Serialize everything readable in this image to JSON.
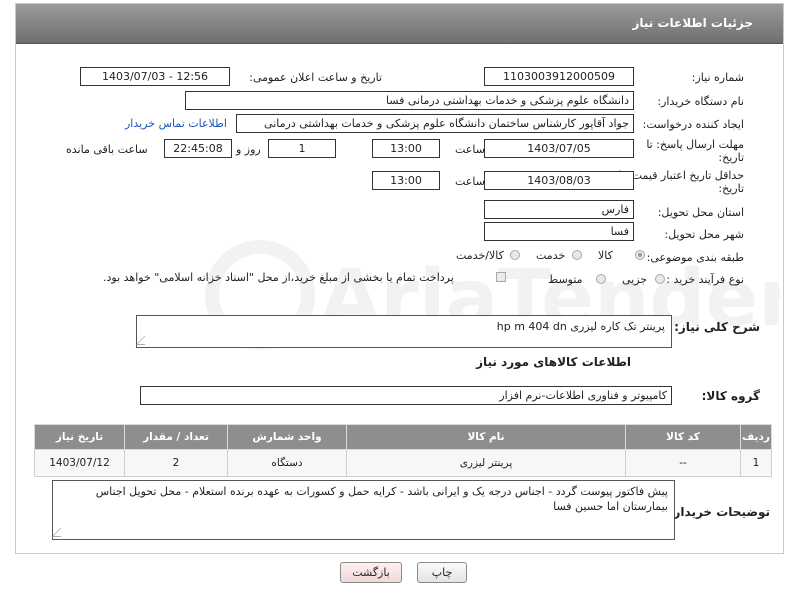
{
  "header": {
    "title": "جزئیات اطلاعات نیاز"
  },
  "need_number": {
    "label": "شماره نیاز:",
    "value": "1103003912000509"
  },
  "announce": {
    "label": "تاریخ و ساعت اعلان عمومی:",
    "value": "1403/07/03 - 12:56"
  },
  "buyer_org": {
    "label": "نام دستگاه خریدار:",
    "value": "دانشگاه علوم پزشکی و خدمات بهداشتی درمانی فسا"
  },
  "creator": {
    "label": "ایجاد کننده درخواست:",
    "value": "جواد آقاپور کارشناس ساختمان دانشگاه علوم پزشکی و خدمات بهداشتی درمانی",
    "contact_link": "اطلاعات تماس خریدار"
  },
  "reply_deadline": {
    "label_line1": "مهلت ارسال پاسخ: تا",
    "label_line2": "تاریخ:",
    "date": "1403/07/05",
    "time_label": "ساعت",
    "time": "13:00",
    "days": "1",
    "days_label": "روز و",
    "remaining": "22:45:08",
    "remaining_label": "ساعت باقی مانده"
  },
  "price_validity": {
    "label_line1": "حداقل تاریخ اعتبار قیمت: تا",
    "label_line2": "تاریخ:",
    "date": "1403/08/03",
    "time_label": "ساعت",
    "time": "13:00"
  },
  "province": {
    "label": "استان محل تحویل:",
    "value": "فارس"
  },
  "city": {
    "label": "شهر محل تحویل:",
    "value": "فسا"
  },
  "category": {
    "label": "طبقه بندی موضوعی:",
    "options": [
      "کالا",
      "خدمت",
      "کالا/خدمت"
    ],
    "selected": "کالا"
  },
  "purchase_process": {
    "label": "نوع فرآیند خرید :",
    "options": [
      "جزیی",
      "متوسط"
    ],
    "note": "پرداخت تمام یا بخشی از مبلغ خرید،از محل \"اسناد خزانه اسلامی\" خواهد بود."
  },
  "description": {
    "label": "شرح کلی نیاز:",
    "value": "پرینتر تک کاره لیزری hp m 404 dn"
  },
  "goods_info": {
    "title": "اطلاعات کالاهای مورد نیاز"
  },
  "goods_group": {
    "label": "گروه کالا:",
    "value": "کامپیوتر و فناوری اطلاعات-نرم افزار"
  },
  "items_table": {
    "headers": [
      "ردیف",
      "کد کالا",
      "نام کالا",
      "واحد شمارش",
      "تعداد / مقدار",
      "تاریخ نیاز"
    ],
    "rows": [
      [
        "1",
        "--",
        "پرینتر لیزری",
        "دستگاه",
        "2",
        "1403/07/12"
      ]
    ]
  },
  "buyer_notes": {
    "label": "توضیحات خریدار:",
    "value": "پیش فاکتور پیوست گردد - اجناس درجه یک و ایرانی باشد - کرایه حمل و کسورات به عهده برنده استعلام - محل تحویل اجناس بیمارستان اما حسین فسا"
  },
  "buttons": {
    "print": "چاپ",
    "back": "بازگشت"
  },
  "watermark": {
    "text": "AriaTender.neT"
  },
  "colors": {
    "header_bg": "#808080",
    "link": "#1a56b8",
    "table_header": "#8e8e8e"
  }
}
